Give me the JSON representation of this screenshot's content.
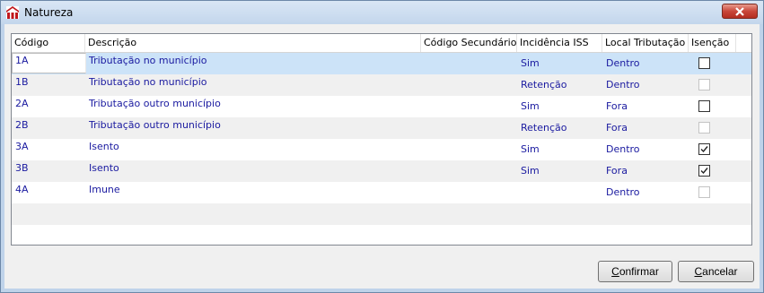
{
  "window": {
    "title": "Natureza"
  },
  "columns": [
    "Código",
    "Descrição",
    "Código Secundário",
    "Incidência ISS",
    "Local Tributação",
    "Isenção"
  ],
  "rows": [
    {
      "codigo": "1A",
      "descricao": "Tributação no município",
      "codigo_secundario": "",
      "incidencia": "Sim",
      "local": "Dentro",
      "isencao": false,
      "isencao_enabled": true
    },
    {
      "codigo": "1B",
      "descricao": "Tributação no município",
      "codigo_secundario": "",
      "incidencia": "Retenção",
      "local": "Dentro",
      "isencao": false,
      "isencao_enabled": false
    },
    {
      "codigo": "2A",
      "descricao": "Tributação outro município",
      "codigo_secundario": "",
      "incidencia": "Sim",
      "local": "Fora",
      "isencao": false,
      "isencao_enabled": true
    },
    {
      "codigo": "2B",
      "descricao": "Tributação outro município",
      "codigo_secundario": "",
      "incidencia": "Retenção",
      "local": "Fora",
      "isencao": false,
      "isencao_enabled": false
    },
    {
      "codigo": "3A",
      "descricao": "Isento",
      "codigo_secundario": "",
      "incidencia": "Sim",
      "local": "Dentro",
      "isencao": true,
      "isencao_enabled": true
    },
    {
      "codigo": "3B",
      "descricao": "Isento",
      "codigo_secundario": "",
      "incidencia": "Sim",
      "local": "Fora",
      "isencao": true,
      "isencao_enabled": true
    },
    {
      "codigo": "4A",
      "descricao": "Imune",
      "codigo_secundario": "",
      "incidencia": "",
      "local": "Dentro",
      "isencao": false,
      "isencao_enabled": false
    }
  ],
  "selected_row": 0,
  "buttons": {
    "confirm": {
      "mnemonic": "C",
      "rest": "onfirmar"
    },
    "cancel": {
      "mnemonic": "C",
      "rest": "ancelar"
    }
  },
  "icons": {
    "app": "app-logo-icon",
    "close": "close-icon",
    "check": "checkmark-icon"
  },
  "colors": {
    "accent": "#cce3f8",
    "cell_text": "#1a1aa0",
    "close_button": "#c9473a"
  }
}
